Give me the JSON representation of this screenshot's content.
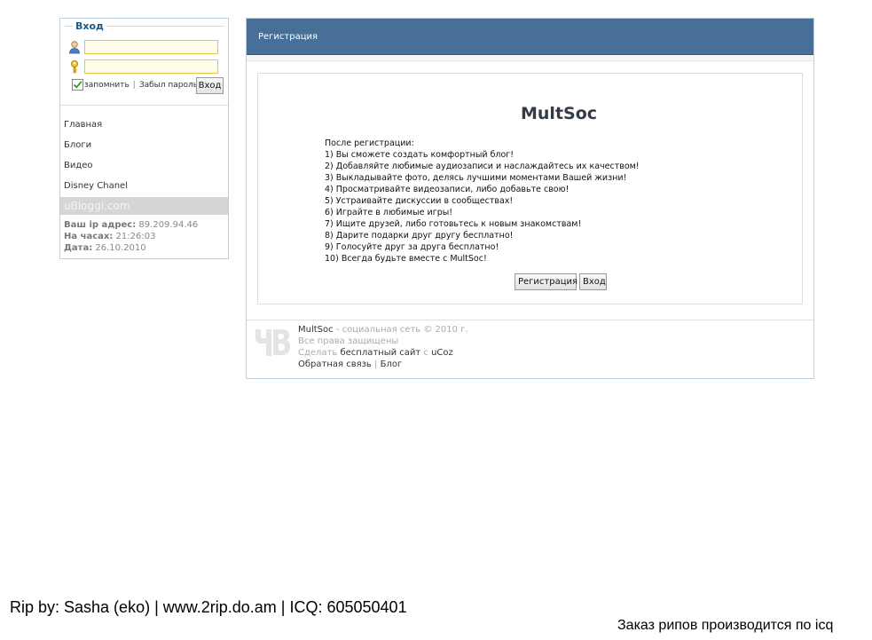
{
  "sidebar": {
    "login_title": "Вход",
    "remember_label": "запомнить",
    "separator": "|",
    "forgot_label": "Забыл пароль",
    "login_button": "Вход",
    "nav": [
      "Главная",
      "Блоги",
      "Видео",
      "Disney Chanel"
    ],
    "brand": "uBloggi.com",
    "info": {
      "ip_label": "Ваш ip адрес:",
      "ip_value": "89.209.94.46",
      "time_label": "На часах:",
      "time_value": "21:26:03",
      "date_label": "Дата:",
      "date_value": "26.10.2010"
    }
  },
  "main": {
    "header_title": "Регистрация",
    "site_title": "MultSoc",
    "intro": "После регистрации:",
    "benefits": [
      "1) Вы сможете создать комфортный блог!",
      "2) Добавляйте любимые аудиозаписи и наслаждайтесь их качеством!",
      "3) Выкладывайте фото, делясь лучшими моментами Вашей жизни!",
      "4) Просматривайте видеозаписи, либо добавьте свою!",
      "5) Устраивайте дискуссии в сообществах!",
      "6) Играйте в любимые игры!",
      "7) Ищите друзей, либо готовьтесь к новым знакомствам!",
      "8) Дарите подарки друг другу бесплатно!",
      "9) Голосуйте друг за друга бесплатно!",
      "10) Всегда будьте вместе с MultSoc!"
    ],
    "register_button": "Регистрация",
    "enter_button": "Вход"
  },
  "footer": {
    "site_link": "MultSoc",
    "copyright": " - социальная сеть © 2010 г.",
    "rights": "Все права защищены",
    "make_label": "Сделать ",
    "free_site_link": "бесплатный сайт",
    "with_label": " с ",
    "ucoz_link": "uCoz",
    "feedback_link": "Обратная связь",
    "pipe": " | ",
    "blog_link": "Блог"
  },
  "captions": {
    "rip_line": "Rip by: Sasha (eko) | www.2rip.do.am | ICQ: 605050401",
    "order_line": "Заказ рипов производится по icq"
  }
}
